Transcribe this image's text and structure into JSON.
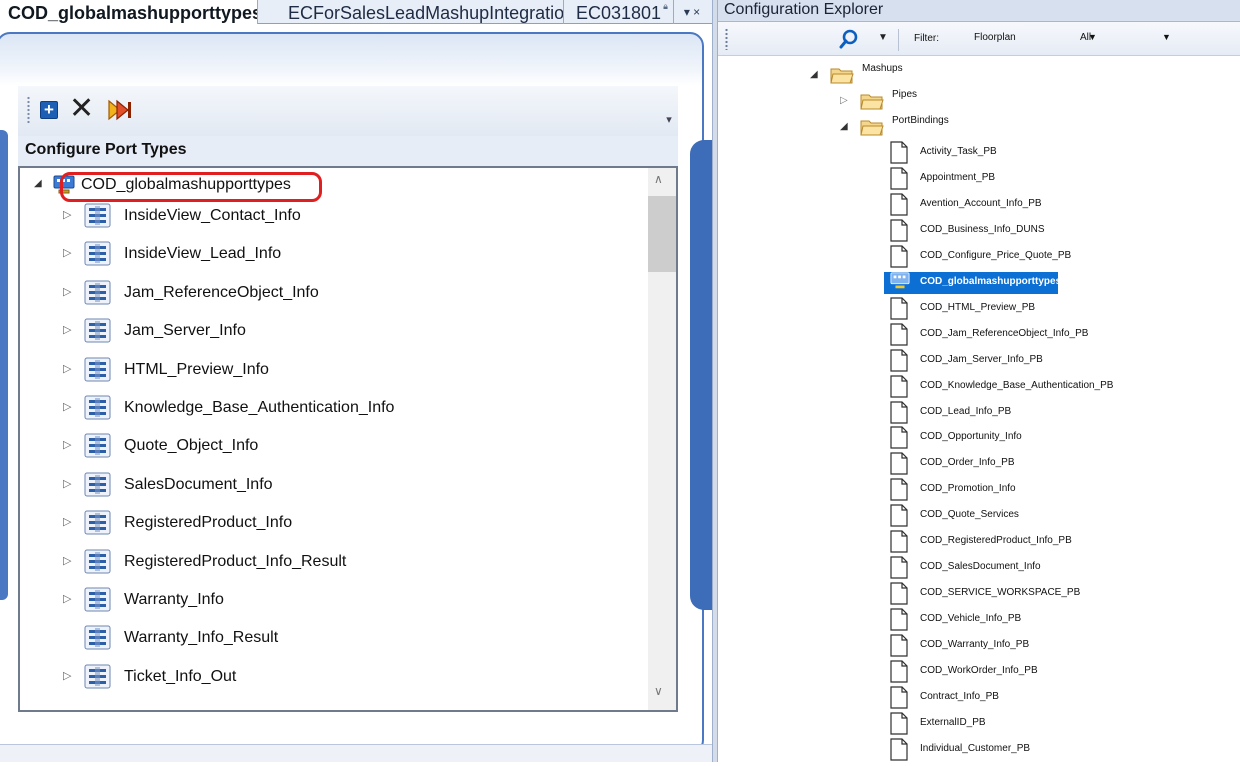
{
  "doc_tabs": [
    {
      "label": "COD_globalmashupporttypes",
      "active": true,
      "locked": true
    },
    {
      "label": "ECForSalesLeadMashupIntegration",
      "active": false,
      "locked": false
    },
    {
      "label": "EC031801",
      "active": false,
      "locked": true
    }
  ],
  "tab_menu": "▾ ×",
  "toolbar": {
    "icons": [
      "add-icon",
      "delete-icon",
      "run-icon"
    ],
    "overflow": "▾"
  },
  "designer": {
    "section_title": "Configure Port Types",
    "root": {
      "label": "COD_globalmashupporttypes",
      "highlighted": true
    },
    "items": [
      {
        "label": "InsideView_Contact_Info",
        "expandable": true
      },
      {
        "label": "InsideView_Lead_Info",
        "expandable": true
      },
      {
        "label": "Jam_ReferenceObject_Info",
        "expandable": true
      },
      {
        "label": "Jam_Server_Info",
        "expandable": true
      },
      {
        "label": "HTML_Preview_Info",
        "expandable": true
      },
      {
        "label": "Knowledge_Base_Authentication_Info",
        "expandable": true
      },
      {
        "label": "Quote_Object_Info",
        "expandable": true
      },
      {
        "label": "SalesDocument_Info",
        "expandable": true
      },
      {
        "label": "RegisteredProduct_Info",
        "expandable": true
      },
      {
        "label": "RegisteredProduct_Info_Result",
        "expandable": true
      },
      {
        "label": "Warranty_Info",
        "expandable": true
      },
      {
        "label": "Warranty_Info_Result",
        "expandable": false
      },
      {
        "label": "Ticket_Info_Out",
        "expandable": true
      }
    ]
  },
  "config_explorer": {
    "title": "Configuration Explorer",
    "filter_label": "Filter:",
    "filter_value": "Floorplan",
    "scope_value": "All",
    "tree": {
      "root": "Mashups",
      "folders": [
        "Pipes",
        "PortBindings"
      ],
      "files": [
        "Activity_Task_PB",
        "Appointment_PB",
        "Avention_Account_Info_PB",
        "COD_Business_Info_DUNS",
        "COD_Configure_Price_Quote_PB",
        "COD_globalmashupporttypes",
        "COD_HTML_Preview_PB",
        "COD_Jam_ReferenceObject_Info_PB",
        "COD_Jam_Server_Info_PB",
        "COD_Knowledge_Base_Authentication_PB",
        "COD_Lead_Info_PB",
        "COD_Opportunity_Info",
        "COD_Order_Info_PB",
        "COD_Promotion_Info",
        "COD_Quote_Services",
        "COD_RegisteredProduct_Info_PB",
        "COD_SalesDocument_Info",
        "COD_SERVICE_WORKSPACE_PB",
        "COD_Vehicle_Info_PB",
        "COD_Warranty_Info_PB",
        "COD_WorkOrder_Info_PB",
        "Contract_Info_PB",
        "ExternalID_PB",
        "Individual_Customer_PB"
      ],
      "selected_file": "COD_globalmashupporttypes"
    }
  },
  "colors": {
    "accent": "#4a78c2",
    "selection": "#0c6fd4",
    "highlight_ring": "#e02020"
  }
}
